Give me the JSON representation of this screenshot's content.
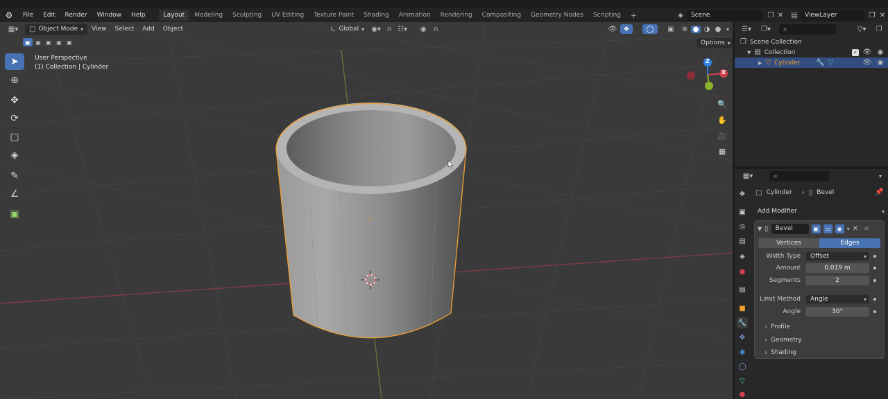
{
  "topbar": {
    "menus": [
      "File",
      "Edit",
      "Render",
      "Window",
      "Help"
    ],
    "workspaces": [
      "Layout",
      "Modeling",
      "Sculpting",
      "UV Editing",
      "Texture Paint",
      "Shading",
      "Animation",
      "Rendering",
      "Compositing",
      "Geometry Nodes",
      "Scripting"
    ],
    "active_workspace": "Layout",
    "add_tab": "+",
    "scene": "Scene",
    "view_layer": "ViewLayer"
  },
  "viewport": {
    "mode": "Object Mode",
    "menus": [
      "View",
      "Select",
      "Add",
      "Object"
    ],
    "orientation": "Global",
    "options": "Options",
    "info_line1": "User Perspective",
    "info_line2": "(1) Collection | Cylinder",
    "gizmo_x": "X",
    "gizmo_z": "Z"
  },
  "outliner": {
    "scene_collection": "Scene Collection",
    "collection": "Collection",
    "object": "Cylinder"
  },
  "properties": {
    "breadcrumb_object": "Cylinder",
    "breadcrumb_modifier": "Bevel",
    "add_modifier": "Add Modifier",
    "modifier_name": "Bevel",
    "affect_vertices": "Vertices",
    "affect_edges": "Edges",
    "width_type_label": "Width Type",
    "width_type_value": "Offset",
    "amount_label": "Amount",
    "amount_value": "0.019 m",
    "segments_label": "Segments",
    "segments_value": "2",
    "limit_method_label": "Limit Method",
    "limit_method_value": "Angle",
    "angle_label": "Angle",
    "angle_value": "30°",
    "panels": [
      "Profile",
      "Geometry",
      "Shading"
    ]
  },
  "colors": {
    "accent": "#4772b3",
    "selection_outline": "#f0a030",
    "x_axis": "#d0404c",
    "y_axis": "#8ab42c",
    "z_axis": "#2f83e6"
  }
}
